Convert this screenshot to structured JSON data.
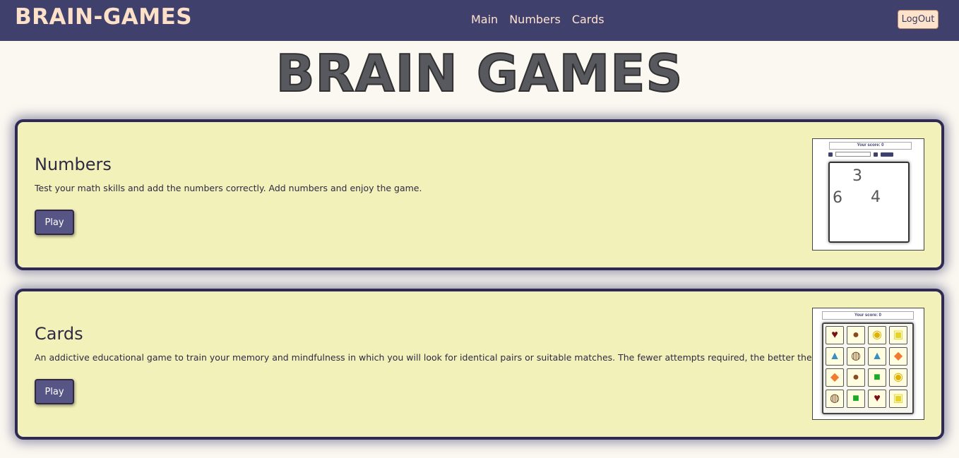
{
  "app": {
    "brand": "BRAIN-GAMES"
  },
  "nav": {
    "items": [
      "Main",
      "Numbers",
      "Cards"
    ],
    "logout_label": "LogOut"
  },
  "page": {
    "title": "BRAIN GAMES"
  },
  "games": [
    {
      "title": "Numbers",
      "description": "Test your math skills and add the numbers correctly. Add numbers and enjoy the game.",
      "play_label": "Play",
      "preview": {
        "score_label": "Your score: 0",
        "numbers": [
          "3",
          "6",
          "4"
        ]
      }
    },
    {
      "title": "Cards",
      "description": "An addictive educational game to train your memory and mindfulness in which you will look for identical pairs or suitable matches. The fewer attempts required, the better the result.",
      "play_label": "Play",
      "preview": {
        "score_label": "Your score: 0",
        "tiles": [
          "heart-icon",
          "bear-icon",
          "bee-icon",
          "sponge-icon",
          "shark-icon",
          "owl-icon",
          "shark-icon",
          "fish-icon",
          "fish-icon",
          "bear-icon",
          "crewmate-icon",
          "bee-icon",
          "owl-icon",
          "crewmate-icon",
          "heart-icon",
          "sponge-icon"
        ]
      }
    }
  ],
  "colors": {
    "navbar": "#40406d",
    "brand": "#fde0c8",
    "card_bg": "#f2f1b9",
    "card_border": "#2e2a55",
    "button": "#565585"
  }
}
